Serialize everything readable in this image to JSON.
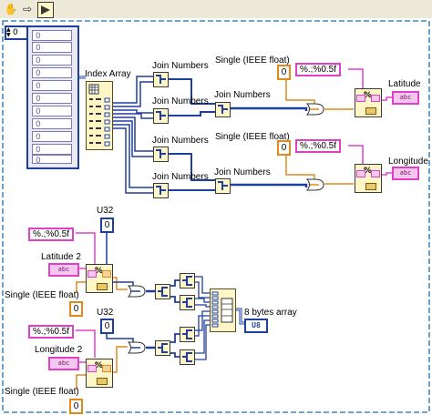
{
  "toolbar": {
    "hand_icon": "hand-icon",
    "arrow_icon": "arrow-right-icon",
    "run_icon": "run-arrow-icon"
  },
  "array_control": {
    "index": "0",
    "elements": [
      "0",
      "0",
      "0",
      "0",
      "0",
      "0",
      "0",
      "0",
      "0",
      "0",
      "0"
    ]
  },
  "top": {
    "index_array_label": "Index Array",
    "join1_label": "Join Numbers",
    "join2_label": "Join Numbers",
    "join3_label": "Join Numbers",
    "join4_label": "Join Numbers",
    "join5_label": "Join Numbers",
    "join6_label": "Join Numbers",
    "single1_label": "Single (IEEE float)",
    "single2_label": "Single (IEEE float)",
    "num1": "0",
    "num2": "0",
    "fmt1": "%.;%0.5f",
    "fmt2": "%.;%0.5f",
    "lat_label": "Latitude",
    "lon_label": "Longitude",
    "abc": "abc"
  },
  "bottom": {
    "fmt1": "%.;%0.5f",
    "fmt2": "%.;%0.5f",
    "u32_1_label": "U32",
    "u32_2_label": "U32",
    "u32_1_val": "0",
    "u32_2_val": "0",
    "lat2_label": "Latitude 2",
    "lon2_label": "Longitude 2",
    "single1_label": "Single (IEEE float)",
    "single2_label": "Single (IEEE float)",
    "num1": "0",
    "num2": "0",
    "bytes_label": "8 bytes array",
    "u8": "U8",
    "abc": "abc"
  },
  "colors": {
    "u32_wire": "#1f3f9f",
    "u8_wire": "#1f3f9f",
    "string_wire": "#e040c8",
    "single_wire": "#e08a1e",
    "frame_dash": "#1a6fb0"
  }
}
